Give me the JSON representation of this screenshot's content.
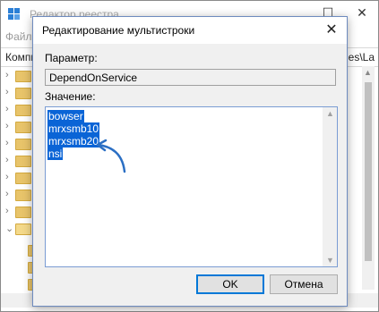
{
  "background_window": {
    "title": "Редактор реестра",
    "menu": "Файл",
    "address_left": "Компь",
    "address_right": "es\\La"
  },
  "dialog": {
    "title": "Редактирование мультистроки",
    "param_label": "Параметр:",
    "param_value": "DependOnService",
    "value_label": "Значение:",
    "value_lines": [
      "bowser",
      "mrxsmb10",
      "mrxsmb20",
      "nsi"
    ],
    "ok_label": "OK",
    "cancel_label": "Отмена"
  },
  "colors": {
    "selection": "#0a64d6",
    "accent_border": "#0078d7",
    "annotation_arrow": "#2b6fc4"
  },
  "icons": {
    "close": "close-icon",
    "annotation": "curved-arrow-icon"
  }
}
